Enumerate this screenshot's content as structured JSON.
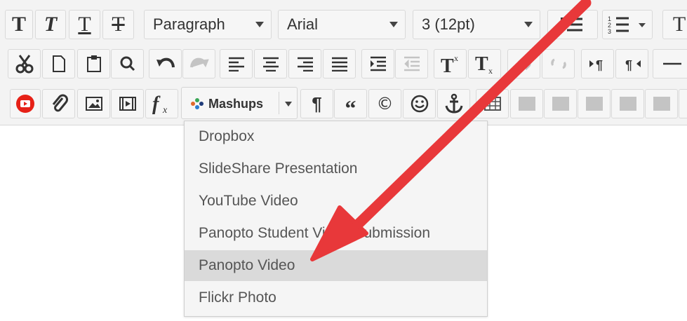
{
  "toolbar": {
    "row1": {
      "format_select": "Paragraph",
      "font_select": "Arial",
      "size_select": "3 (12pt)"
    },
    "row3": {
      "mashups_label": "Mashups"
    }
  },
  "mashups_menu": {
    "items": [
      {
        "label": "Dropbox"
      },
      {
        "label": "SlideShare Presentation"
      },
      {
        "label": "YouTube Video"
      },
      {
        "label": "Panopto Student Video Submission"
      },
      {
        "label": "Panopto Video"
      },
      {
        "label": "Flickr Photo"
      }
    ],
    "highlighted_index": 4
  },
  "colors": {
    "arrow": "#e8383a",
    "highlight": "#dadada",
    "youtube_red": "#e62117"
  }
}
